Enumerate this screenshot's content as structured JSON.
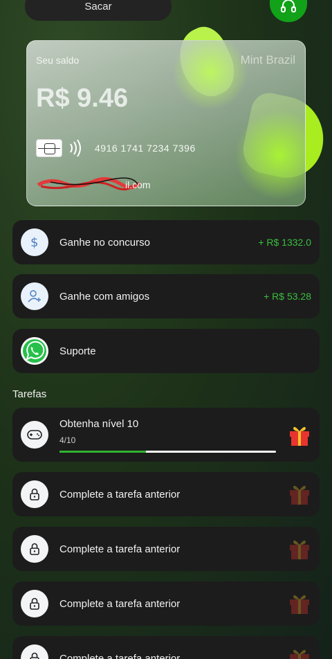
{
  "header": {
    "withdraw_label": "Sacar",
    "support_icon": "headset-icon"
  },
  "card": {
    "balance_label": "Seu saldo",
    "brand": "Mint Brazil",
    "balance": "R$ 9.46",
    "number": "4916 1741 7234 7396",
    "email_visible": "il.com"
  },
  "rows": [
    {
      "label": "Ganhe no concurso",
      "amount": "+ R$ 1332.0",
      "icon": "dollar-icon"
    },
    {
      "label": "Ganhe com amigos",
      "amount": "+ R$ 53.28",
      "icon": "add-user-icon"
    },
    {
      "label": "Suporte",
      "icon": "whatsapp-icon"
    }
  ],
  "tasks_title": "Tarefas",
  "tasks": [
    {
      "title": "Obtenha nível 10",
      "progress_text": "4/10",
      "progress": 0.4,
      "icon": "gamepad-icon"
    }
  ],
  "locked_tasks": [
    {
      "label": "Complete a tarefa anterior",
      "icon": "lock-icon"
    },
    {
      "label": "Complete a tarefa anterior",
      "icon": "lock-icon"
    },
    {
      "label": "Complete a tarefa anterior",
      "icon": "lock-icon"
    },
    {
      "label": "Complete a tarefa anterior",
      "icon": "lock-icon"
    }
  ],
  "colors": {
    "accent_green": "#2fb52f",
    "amount_green": "#3bbf3f",
    "panel": "#1c1c1c"
  }
}
